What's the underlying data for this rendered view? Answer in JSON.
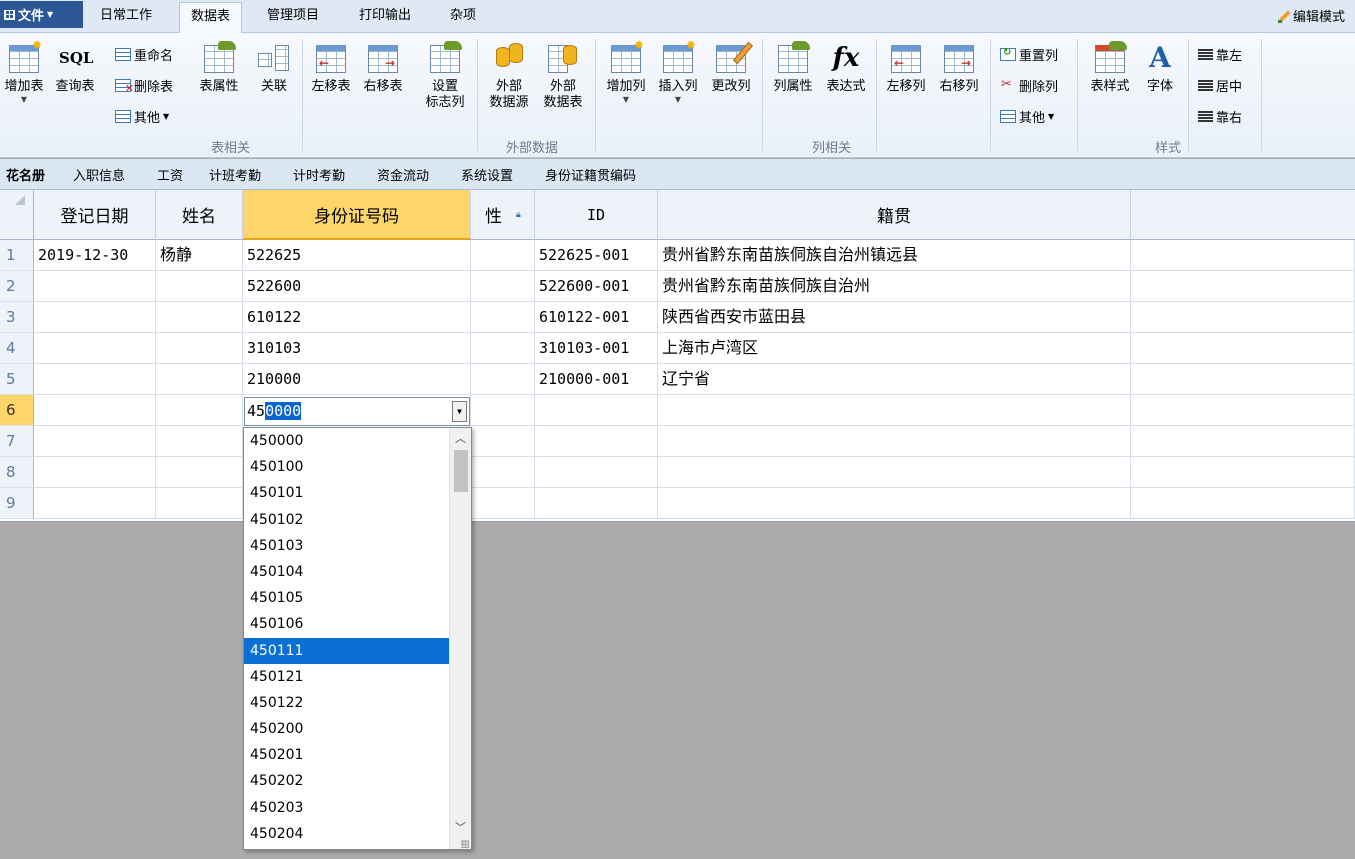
{
  "menu": {
    "file_label": "文件",
    "tabs": [
      {
        "label": "日常工作",
        "active": false
      },
      {
        "label": "数据表",
        "active": true
      },
      {
        "label": "管理项目",
        "active": false
      },
      {
        "label": "打印输出",
        "active": false
      },
      {
        "label": "杂项",
        "active": false
      }
    ],
    "edit_mode_label": "编辑模式"
  },
  "ribbon": {
    "add_table": "增加表",
    "query_table": "查询表",
    "sql_text": "SQL",
    "rename": "重命名",
    "delete_table": "删除表",
    "other1": "其他",
    "table_props": "表属性",
    "relation": "关联",
    "move_table_left": "左移表",
    "move_table_right": "右移表",
    "set_flag_col_line1": "设置",
    "set_flag_col_line2": "标志列",
    "group_table": "表相关",
    "ext_source_line1": "外部",
    "ext_source_line2": "数据源",
    "ext_table_line1": "外部",
    "ext_table_line2": "数据表",
    "group_external": "外部数据",
    "add_col": "增加列",
    "insert_col": "插入列",
    "change_col": "更改列",
    "col_props": "列属性",
    "expression": "表达式",
    "fx_text": "fx",
    "move_col_left": "左移列",
    "move_col_right": "右移列",
    "reset_col": "重置列",
    "delete_col": "删除列",
    "other2": "其他",
    "group_column": "列相关",
    "table_style": "表样式",
    "font": "字体",
    "font_glyph": "A",
    "align_left": "靠左",
    "align_center": "居中",
    "align_right": "靠右",
    "group_style": "样式"
  },
  "sheet_tabs": [
    "花名册",
    "入职信息",
    "工资",
    "计班考勤",
    "计时考勤",
    "资金流动",
    "系统设置",
    "身份证籍贯编码"
  ],
  "grid": {
    "columns": [
      "登记日期",
      "姓名",
      "身份证号码",
      "性",
      "ID",
      "籍贯"
    ],
    "row_numbers": [
      "1",
      "2",
      "3",
      "4",
      "5",
      "6",
      "7",
      "8",
      "9"
    ],
    "rows": [
      [
        "2019-12-30",
        "杨静",
        "522625",
        "",
        "522625-001",
        "贵州省黔东南苗族侗族自治州镇远县"
      ],
      [
        "",
        "",
        "522600",
        "",
        "522600-001",
        "贵州省黔东南苗族侗族自治州"
      ],
      [
        "",
        "",
        "610122",
        "",
        "610122-001",
        "陕西省西安市蓝田县"
      ],
      [
        "",
        "",
        "310103",
        "",
        "310103-001",
        "上海市卢湾区"
      ],
      [
        "",
        "",
        "210000",
        "",
        "210000-001",
        "辽宁省"
      ],
      [
        "",
        "",
        "",
        "",
        "",
        ""
      ],
      [
        "",
        "",
        "",
        "",
        "",
        ""
      ],
      [
        "",
        "",
        "",
        "",
        "",
        ""
      ],
      [
        "",
        "",
        "",
        "",
        "",
        ""
      ]
    ],
    "current_row": "6",
    "editor": {
      "typed": "45",
      "autocomplete": "0000"
    }
  },
  "dropdown": {
    "options": [
      "450000",
      "450100",
      "450101",
      "450102",
      "450103",
      "450104",
      "450105",
      "450106",
      "450111",
      "450121",
      "450122",
      "450200",
      "450201",
      "450202",
      "450203",
      "450204"
    ],
    "selected": "450111"
  },
  "colors": {
    "accent": "#2b5797",
    "selection": "#0a70d6",
    "header_selected": "#fcd66a"
  }
}
